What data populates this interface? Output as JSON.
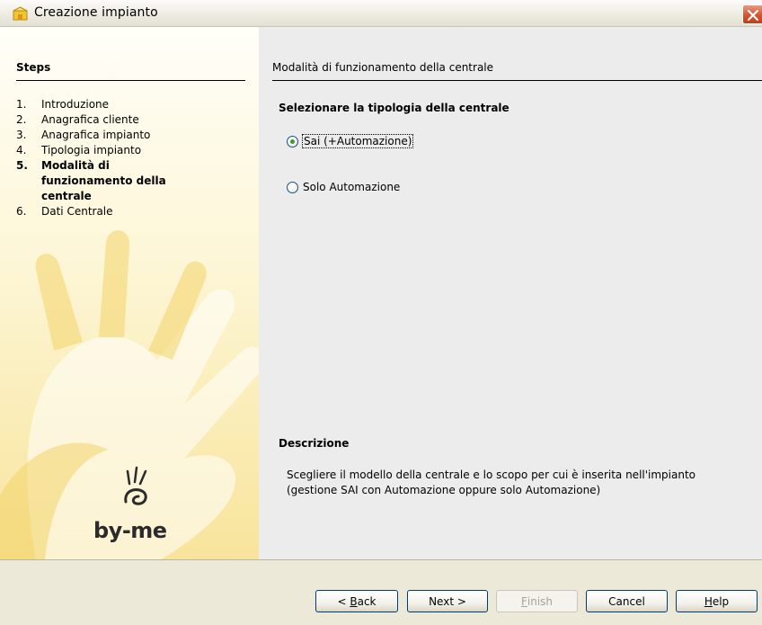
{
  "window": {
    "title": "Creazione impianto"
  },
  "sidebar": {
    "heading": "Steps",
    "steps": [
      {
        "num": "1.",
        "label": "Introduzione"
      },
      {
        "num": "2.",
        "label": "Anagrafica cliente"
      },
      {
        "num": "3.",
        "label": "Anagrafica impianto"
      },
      {
        "num": "4.",
        "label": "Tipologia impianto"
      },
      {
        "num": "5.",
        "label": "Modalità di funzionamento della centrale"
      },
      {
        "num": "6.",
        "label": "Dati Centrale"
      }
    ],
    "current_step_index": 4,
    "logo_text": "by-me"
  },
  "main": {
    "title": "Modalità di funzionamento della centrale",
    "question": "Selezionare la tipologia della centrale",
    "options": [
      {
        "label": "Sai (+Automazione)",
        "checked": true
      },
      {
        "label": "Solo Automazione",
        "checked": false
      }
    ],
    "description_heading": "Descrizione",
    "description_lines": [
      "Scegliere il modello della centrale e lo scopo per cui è inserita nell'impianto",
      "(gestione SAI  con Automazione oppure solo  Automazione)"
    ]
  },
  "buttons": {
    "back": {
      "prefix": "< ",
      "mnemonic": "B",
      "rest": "ack"
    },
    "next": "Next >",
    "finish": {
      "mnemonic": "F",
      "rest": "inish",
      "enabled": false
    },
    "cancel": "Cancel",
    "help": {
      "mnemonic": "H",
      "rest": "elp"
    }
  },
  "colors": {
    "close_button": "#d5532f",
    "sidebar_gradient_end": "#f8e49b",
    "content_bg": "#ececec",
    "footer_bg": "#ece9d8"
  }
}
